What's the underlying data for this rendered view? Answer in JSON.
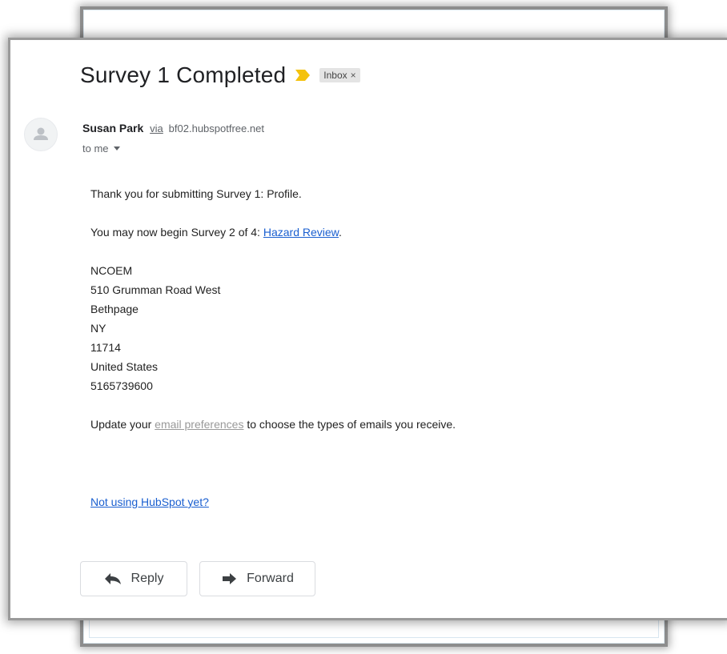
{
  "email": {
    "subject": "Survey 1 Completed",
    "label": "Inbox",
    "label_close": "×",
    "sender": {
      "name": "Susan Park",
      "via": "via",
      "domain": "bf02.hubspotfree.net"
    },
    "recipient": "to me",
    "body": {
      "line1": "Thank you for submitting Survey 1: Profile.",
      "line2_prefix": "You may now begin Survey 2 of 4: ",
      "line2_link": "Hazard Review",
      "line2_suffix": ".",
      "address": [
        "NCOEM",
        "510 Grumman Road West",
        "Bethpage",
        "NY",
        "11714",
        "United States",
        "5165739600"
      ],
      "prefs_prefix": "Update your ",
      "prefs_link": "email preferences",
      "prefs_suffix": " to choose the types of emails you receive."
    },
    "footer_link": "Not using HubSpot yet?"
  },
  "actions": {
    "reply_label": "Reply",
    "forward_label": "Forward"
  },
  "icons": {
    "importance": "importance-marker-icon",
    "avatar": "person-avatar-icon",
    "reply": "reply-arrow-icon",
    "forward": "forward-arrow-icon",
    "dropdown": "caret-down-icon"
  },
  "colors": {
    "importance": "#f4c20d",
    "link": "#1a5fd0",
    "muted_link": "#999999"
  }
}
